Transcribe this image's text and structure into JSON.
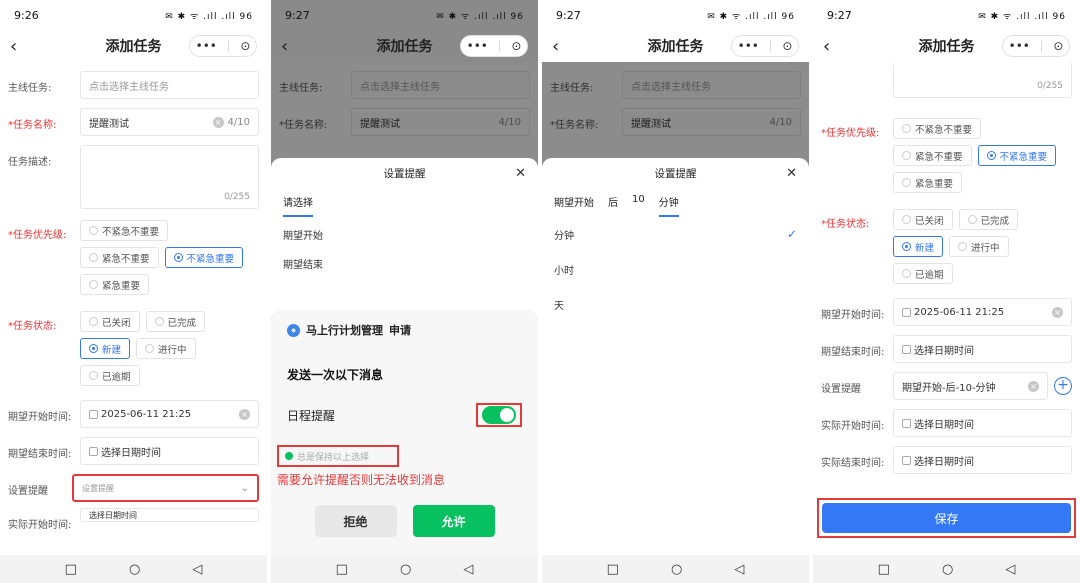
{
  "nav": {
    "title": "添加任务",
    "more": "•••",
    "record": "⊙",
    "back": "‹"
  },
  "bottom_nav": {
    "square": "□",
    "circle": "○",
    "back": "◁"
  },
  "phone1": {
    "status": {
      "time": "9:26",
      "icons": "✉ ✱ ᯤ .ıll .ıll 96"
    },
    "main_task": {
      "label": "主线任务:",
      "placeholder": "点击选择主线任务"
    },
    "task_name": {
      "label": "*任务名称:",
      "value": "提醒测试",
      "count": "4/10"
    },
    "task_desc": {
      "label": "任务描述:",
      "count": "0/255"
    },
    "priority": {
      "label": "*任务优先级:",
      "options": [
        "不紧急不重要",
        "紧急不重要",
        "不紧急重要",
        "紧急重要"
      ],
      "selected": "不紧急重要"
    },
    "status_field": {
      "label": "*任务状态:",
      "options": [
        "已关闭",
        "已完成",
        "新建",
        "进行中",
        "已逾期"
      ],
      "selected": "新建"
    },
    "start_time": {
      "label": "期望开始时间:",
      "value": "2025-06-11 21:25"
    },
    "end_time": {
      "label": "期望结束时间:",
      "placeholder": "选择日期时间"
    },
    "reminder": {
      "label": "设置提醒",
      "placeholder": "设置提醒"
    },
    "actual_start": {
      "label": "实际开始时间:",
      "placeholder": "选择日期时间"
    }
  },
  "phone2": {
    "status": {
      "time": "9:27",
      "icons": "✉ ✱ ᯤ .ıll .ıll 96"
    },
    "sheet_title": "设置提醒",
    "tab": "请选择",
    "items": [
      "期望开始",
      "期望结束"
    ],
    "app_name": "马上行计划管理",
    "apply": "申请",
    "send_title": "发送一次以下消息",
    "toggle_label": "日程提醒",
    "keep_label": "总是保持以上选择",
    "warning": "需要允许提醒否则无法收到消息",
    "reject": "拒绝",
    "allow": "允许"
  },
  "phone3": {
    "status": {
      "time": "9:27",
      "icons": "✉ ✱ ᯤ .ıll .ıll 96"
    },
    "sheet_title": "设置提醒",
    "tabs": [
      "期望开始",
      "后",
      "10",
      "分钟"
    ],
    "active_tab": "分钟",
    "items": [
      "分钟",
      "小时",
      "天"
    ],
    "selected": "分钟"
  },
  "phone4": {
    "status": {
      "time": "9:27",
      "icons": "✉ ✱ ᯤ .ıll .ıll 96"
    },
    "desc_count": "0/255",
    "reminder_value": "期望开始-后-10-分钟",
    "save": "保存"
  }
}
